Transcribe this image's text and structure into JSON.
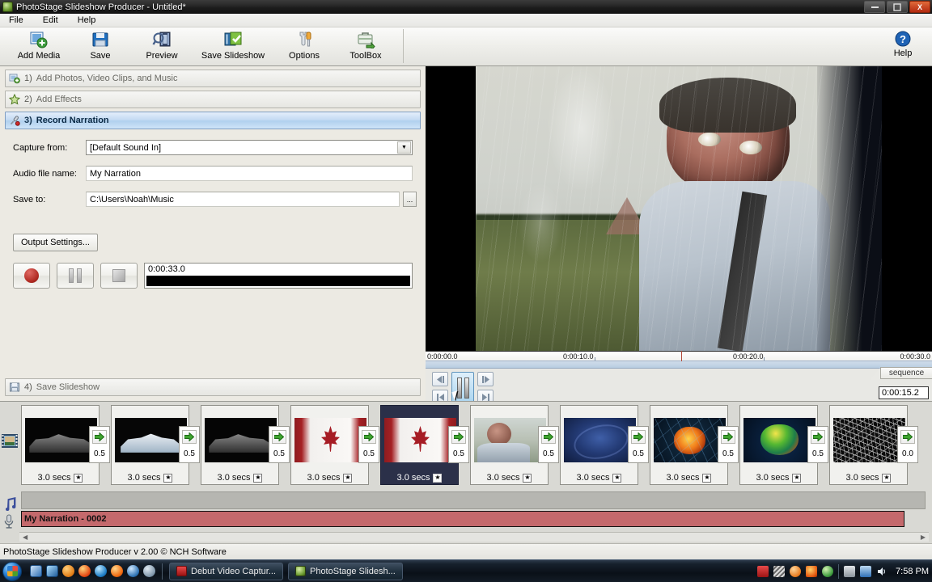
{
  "window": {
    "title": "PhotoStage Slideshow Producer - Untitled*",
    "app_icon": "photostage-icon",
    "minimize": "—",
    "maximize": "❐",
    "close": "X"
  },
  "menu": {
    "items": [
      "File",
      "Edit",
      "Help"
    ]
  },
  "toolbar": {
    "items": [
      {
        "label": "Add Media",
        "icon": "add-media-icon"
      },
      {
        "label": "Save",
        "icon": "floppy-disk-icon"
      },
      {
        "label": "Preview",
        "icon": "preview-magnifier-icon"
      },
      {
        "label": "Save Slideshow",
        "icon": "save-slideshow-icon"
      },
      {
        "label": "Options",
        "icon": "wrench-screwdriver-icon"
      },
      {
        "label": "ToolBox",
        "icon": "toolbox-icon"
      }
    ],
    "help": {
      "label": "Help",
      "icon": "help-question-icon"
    }
  },
  "steps": [
    {
      "num": "1)",
      "label": "Add Photos, Video Clips, and Music",
      "icon": "add-photos-icon",
      "active": false
    },
    {
      "num": "2)",
      "label": "Add Effects",
      "icon": "star-icon",
      "active": false
    },
    {
      "num": "3)",
      "label": "Record Narration",
      "icon": "microphone-icon",
      "active": true
    },
    {
      "num": "4)",
      "label": "Save Slideshow",
      "icon": "save-disk-icon",
      "active": false
    }
  ],
  "record_panel": {
    "capture_from_label": "Capture from:",
    "capture_from_value": "[Default Sound In]",
    "audio_file_label": "Audio file name:",
    "audio_file_value": "My Narration",
    "save_to_label": "Save to:",
    "save_to_value": "C:\\Users\\Noah\\Music",
    "browse_label": "...",
    "output_settings_label": "Output Settings...",
    "record_button": "record-button",
    "pause_button": "pause-button",
    "stop_button": "stop-button",
    "elapsed_time": "0:00:33.0",
    "meter_level_percent": 100
  },
  "preview": {
    "ruler_ticks": [
      {
        "label": "0:00:00.0",
        "pos_pct": 0
      },
      {
        "label": "0:00:10.0",
        "pos_pct": 33.4
      },
      {
        "label": "0:00:20.0",
        "pos_pct": 66.7
      },
      {
        "label": "0:00:30.0",
        "pos_pct": 100
      }
    ],
    "playhead_pct": 50.5,
    "controls": {
      "step_back": "◀|",
      "play_pause": "pause",
      "step_forward": "|▶",
      "skip_start": "|◀",
      "skip_end": "▶|"
    },
    "sequence_tab": "sequence",
    "current_time": "0:00:15.2"
  },
  "filmstrip": {
    "track_icon": "film-strip-icon",
    "slides": [
      {
        "duration": "3.0 secs",
        "thumb": "race-car-dark",
        "selected": false,
        "transition_value": "0.5"
      },
      {
        "duration": "3.0 secs",
        "thumb": "race-car-white",
        "selected": false,
        "transition_value": "0.5"
      },
      {
        "duration": "3.0 secs",
        "thumb": "race-car-dark",
        "selected": false,
        "transition_value": "0.5"
      },
      {
        "duration": "3.0 secs",
        "thumb": "canada-flag",
        "selected": false,
        "transition_value": "0.5"
      },
      {
        "duration": "3.0 secs",
        "thumb": "canada-flag",
        "selected": true,
        "transition_value": "0.5"
      },
      {
        "duration": "3.0 secs",
        "thumb": "man-in-car",
        "selected": false,
        "transition_value": "0.5"
      },
      {
        "duration": "3.0 secs",
        "thumb": "blue-swirl",
        "selected": false,
        "transition_value": "0.5"
      },
      {
        "duration": "3.0 secs",
        "thumb": "apple-orange-glass",
        "selected": false,
        "transition_value": "0.5"
      },
      {
        "duration": "3.0 secs",
        "thumb": "apple-green-art",
        "selected": false,
        "transition_value": "0.5"
      },
      {
        "duration": "3.0 secs",
        "thumb": "gray-sketch",
        "selected": false,
        "transition_value": "0.0"
      }
    ],
    "star_glyph": "★"
  },
  "audio": {
    "music_track_icon": "music-note-icon",
    "narration_track_icon": "microphone-icon",
    "narration_clip_label": "My Narration - 0002",
    "narration_color": "#c4696c",
    "scroll_left": "◀",
    "scroll_right": "▶"
  },
  "status_bar": {
    "text": "PhotoStage Slideshow Producer v 2.00 © NCH Software"
  },
  "taskbar": {
    "start_icon": "windows-start-orb",
    "quick_launch": [
      "show-desktop-icon",
      "flip-3d-icon",
      "vlc-cone-icon",
      "firefox-flame-icon",
      "internet-explorer-icon",
      "firefox-icon",
      "media-player-icon",
      "globe-icon"
    ],
    "tasks": [
      {
        "label": "Debut Video Captur...",
        "icon": "debut-video-icon"
      },
      {
        "label": "PhotoStage Slidesh...",
        "icon": "photostage-icon"
      }
    ],
    "tray_icons": [
      "debut-tray-icon",
      "wave-tray-icon",
      "orange-tray-icon",
      "flame-tray-icon",
      "shield-tray-icon",
      "network-tray-icon",
      "usb-tray-icon",
      "volume-tray-icon"
    ],
    "clock": "7:58 PM"
  }
}
